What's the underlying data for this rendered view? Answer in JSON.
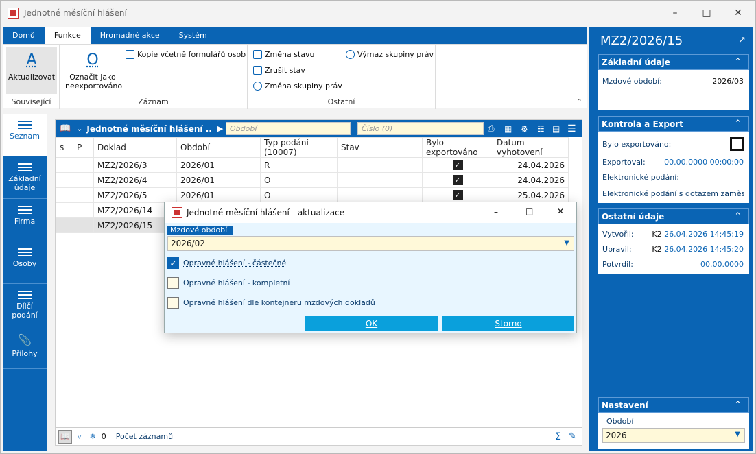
{
  "window": {
    "title": "Jednotné měsíční hlášení"
  },
  "ribbon": {
    "tabs": [
      "Domů",
      "Funkce",
      "Hromadné akce",
      "Systém"
    ],
    "groups": {
      "souvisejici": {
        "label": "Související",
        "btn": "Aktualizovat"
      },
      "zaznam": {
        "label": "Záznam",
        "mark_btn_line1": "Označit jako",
        "mark_btn_line2": "neexportováno",
        "copy_btn": "Kopie včetně formulářů osob"
      },
      "ostatni": {
        "label": "Ostatní",
        "change_state": "Změna stavu",
        "cancel_state": "Zrušit stav",
        "change_group": "Změna skupiny práv",
        "remove_group": "Výmaz skupiny práv"
      }
    }
  },
  "leftnav": {
    "items": [
      {
        "label": "Seznam"
      },
      {
        "label": "Základní údaje"
      },
      {
        "label": "Firma"
      },
      {
        "label": "Osoby"
      },
      {
        "label": "Dílčí podání"
      },
      {
        "label": "Přílohy"
      }
    ]
  },
  "grid": {
    "title": "Jednotné měsíční hlášení ..",
    "filter_period_placeholder": "Období",
    "filter_number_placeholder": "Číslo (0)",
    "columns": [
      "s",
      "P",
      "Doklad",
      "Období",
      "Typ podání (10007)",
      "Stav",
      "Bylo exportováno",
      "Datum vyhotovení"
    ],
    "rows": [
      {
        "doklad": "MZ2/2026/3",
        "obdobi": "2026/01",
        "typ": "R",
        "stav": "",
        "exported": "✓",
        "datum": "24.04.2026"
      },
      {
        "doklad": "MZ2/2026/4",
        "obdobi": "2026/01",
        "typ": "O",
        "stav": "",
        "exported": "✓",
        "datum": "24.04.2026"
      },
      {
        "doklad": "MZ2/2026/5",
        "obdobi": "2026/01",
        "typ": "O",
        "stav": "",
        "exported": "✓",
        "datum": "25.04.2026"
      },
      {
        "doklad": "MZ2/2026/14",
        "obdobi": "",
        "typ": "",
        "stav": "",
        "exported": "",
        "datum": ""
      },
      {
        "doklad": "MZ2/2026/15",
        "obdobi": "",
        "typ": "",
        "stav": "",
        "exported": "",
        "datum": ""
      }
    ],
    "footer": {
      "count": "0",
      "records_label": "Počet záznamů"
    }
  },
  "rightpanel": {
    "title": "MZ2/2026/15",
    "basic": {
      "header": "Základní údaje",
      "period_label": "Mzdové období:",
      "period_value": "2026/03"
    },
    "export": {
      "header": "Kontrola a Export",
      "exported_label": "Bylo exportováno:",
      "exported_by_label": "Exportoval:",
      "exported_by_value": "00.00.0000 00:00:00",
      "e_filing_label": "Elektronické podání:",
      "e_filing_query_label": "Elektronické podání s dotazem zaměstn"
    },
    "other": {
      "header": "Ostatní údaje",
      "created_label": "Vytvořil:",
      "created_user": "K2",
      "created_value": "26.04.2026 14:45:19",
      "modified_label": "Upravil:",
      "modified_user": "K2",
      "modified_value": "26.04.2026 14:45:20",
      "confirmed_label": "Potvrdil:",
      "confirmed_value": "00.00.0000"
    },
    "settings": {
      "header": "Nastavení",
      "period_label": "Období",
      "period_value": "2026"
    }
  },
  "dialog": {
    "title": "Jednotné měsíční hlášení - aktualizace",
    "field_label": "Mzdové období",
    "field_value": "2026/02",
    "options": [
      {
        "label": "Opravné hlášení - částečné",
        "checked": true
      },
      {
        "label": "Opravné hlášení - kompletní",
        "checked": false
      },
      {
        "label": "Opravné hlášení dle kontejneru mzdových dokladů",
        "checked": false
      }
    ],
    "ok_label": "OK",
    "cancel_label": "Storno"
  },
  "colors": {
    "brand": "#0a64b4",
    "button": "#0aa0dc",
    "input_bg": "#fff9d9"
  }
}
